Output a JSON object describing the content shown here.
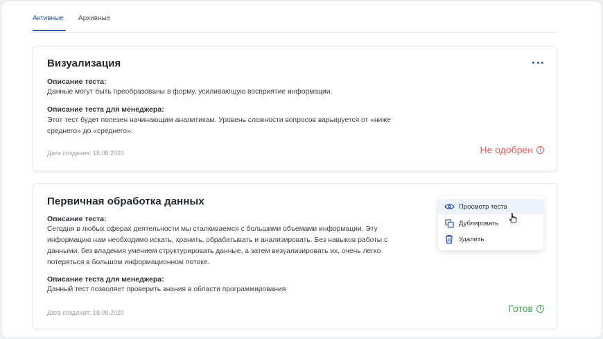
{
  "tabs": {
    "active": "Активные",
    "archived": "Архивные"
  },
  "cards": [
    {
      "title": "Визуализация",
      "desc_label": "Описание теста:",
      "desc_text": "Данные могут быть преобразованы в форму, усиливающую восприятие информации.",
      "manager_label": "Описание теста для менеджера:",
      "manager_text": "Этот тест будет полезен начинающим аналитикам. Уровень сложности вопросов варьируется от «ниже среднего» до «среднего».",
      "date": "Дата создания: 18.08.2020",
      "status": "Не одобрен",
      "status_color": "#e05a5a"
    },
    {
      "title": "Первичная обработка данных",
      "desc_label": "Описание теста:",
      "desc_text": "Сегодня в любых сферах деятельности мы сталкиваемся с большими объемами информации. Эту информацию нам необходимо искать, хранить, обрабатывать и анализировать. Без навыков работы с данными, без владения умением структурировать данные, а затем визуализировать их, очень легко потеряться в большом информационном потоке.",
      "manager_label": "Описание теста для менеджера:",
      "manager_text": "Данный тест позволяет проверить знания в области программирования",
      "date": "Дата создания: 18.08.2020",
      "status": "Готов",
      "status_color": "#3fa65a"
    }
  ],
  "menu": {
    "items": [
      {
        "label": "Просмотр теста",
        "icon": "eye-icon"
      },
      {
        "label": "Дублировать",
        "icon": "duplicate-icon"
      },
      {
        "label": "Удалить",
        "icon": "trash-icon"
      }
    ]
  },
  "colors": {
    "accent": "#2f5aa8",
    "rejected": "#e05a5a",
    "ready": "#3fa65a"
  }
}
